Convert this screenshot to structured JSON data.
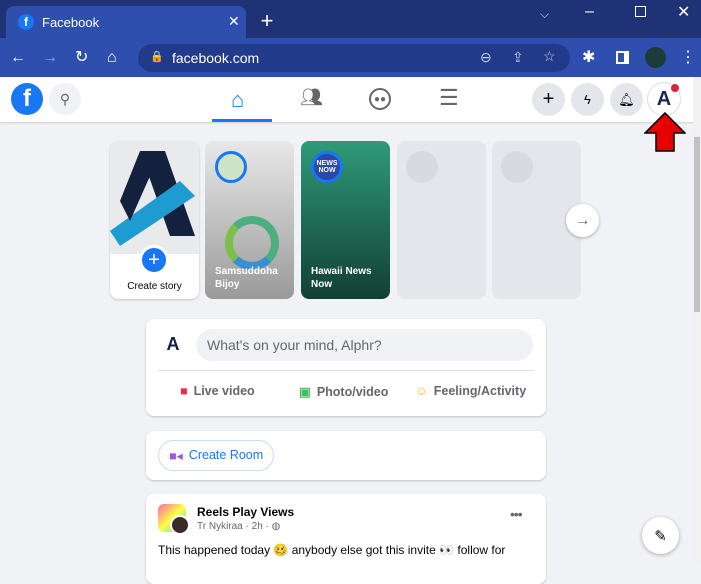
{
  "browser": {
    "tab_title": "Facebook",
    "url": "facebook.com",
    "new_tab": "+"
  },
  "nav": {
    "active": "home"
  },
  "stories": {
    "create_label": "Create story",
    "items": [
      {
        "name": "Samsuddoha Bijoy"
      },
      {
        "name": "Hawaii News Now",
        "badge": "NEWS NOW"
      }
    ]
  },
  "composer": {
    "placeholder": "What's on your mind, Alphr?",
    "actions": [
      "Live video",
      "Photo/video",
      "Feeling/Activity"
    ]
  },
  "room": {
    "label": "Create Room"
  },
  "post": {
    "page": "Reels Play Views",
    "author": "Tr Nykiraa",
    "time": "2h",
    "text": "This happened today 🥴 anybody else got this invite 👀 follow for"
  },
  "colors": {
    "accent": "#1877f2",
    "chrome": "#2f4fae"
  }
}
